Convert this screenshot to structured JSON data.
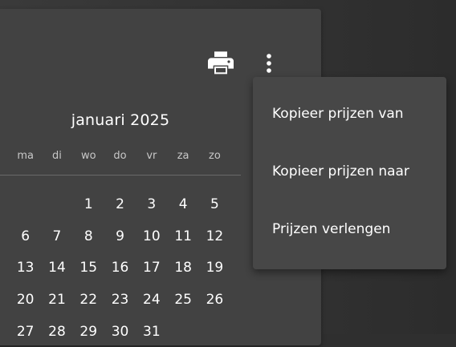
{
  "calendar": {
    "month_title": "januari 2025",
    "weekdays": [
      "ma",
      "di",
      "wo",
      "do",
      "vr",
      "za",
      "zo"
    ],
    "leading_blanks": 2,
    "days": [
      "1",
      "2",
      "3",
      "4",
      "5",
      "6",
      "7",
      "8",
      "9",
      "10",
      "11",
      "12",
      "13",
      "14",
      "15",
      "16",
      "17",
      "18",
      "19",
      "20",
      "21",
      "22",
      "23",
      "24",
      "25",
      "26",
      "27",
      "28",
      "29",
      "30",
      "31"
    ]
  },
  "toolbar": {
    "print_icon": "printer-icon",
    "more_icon": "more-vert-icon"
  },
  "menu": {
    "items": [
      {
        "label": "Kopieer prijzen van"
      },
      {
        "label": "Kopieer prijzen naar"
      },
      {
        "label": "Prijzen verlengen"
      }
    ]
  },
  "colors": {
    "panel": "#424242",
    "menu": "#474747",
    "background": "#2f2f2f",
    "text": "#ffffff",
    "muted_text": "#c8c8c8"
  }
}
